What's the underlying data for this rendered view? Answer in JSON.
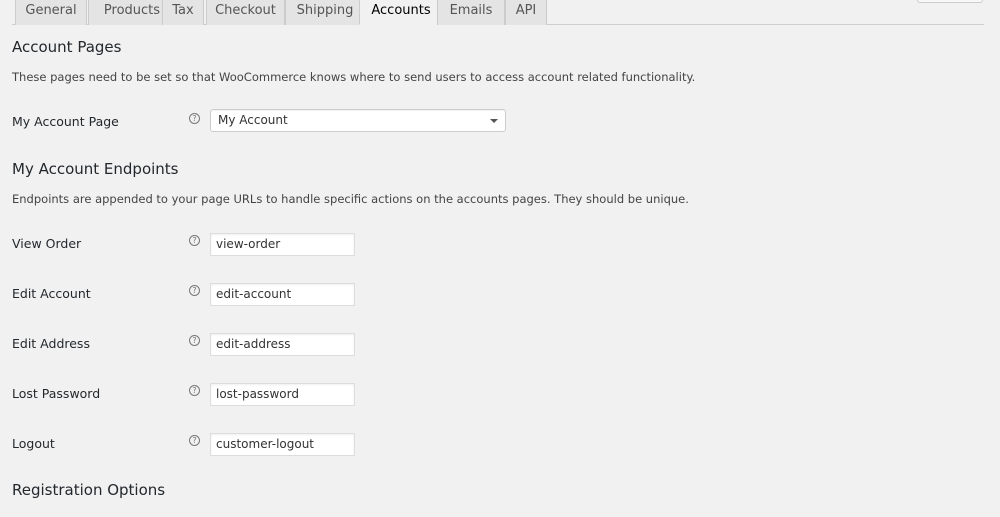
{
  "tabs": [
    {
      "label": "General"
    },
    {
      "label": "Products"
    },
    {
      "label": "Tax"
    },
    {
      "label": "Checkout"
    },
    {
      "label": "Shipping"
    },
    {
      "label": "Accounts",
      "active": true
    },
    {
      "label": "Emails"
    },
    {
      "label": "API"
    }
  ],
  "account_pages": {
    "title": "Account Pages",
    "description": "These pages need to be set so that WooCommerce knows where to send users to access account related functionality.",
    "my_account_page": {
      "label": "My Account Page",
      "value": "My Account",
      "help_icon": "question-mark-icon"
    }
  },
  "endpoints": {
    "title": "My Account Endpoints",
    "description": "Endpoints are appended to your page URLs to handle specific actions on the accounts pages. They should be unique.",
    "fields": [
      {
        "label": "View Order",
        "value": "view-order"
      },
      {
        "label": "Edit Account",
        "value": "edit-account"
      },
      {
        "label": "Edit Address",
        "value": "edit-address"
      },
      {
        "label": "Lost Password",
        "value": "lost-password"
      },
      {
        "label": "Logout",
        "value": "customer-logout"
      }
    ]
  },
  "registration": {
    "title": "Registration Options"
  },
  "help_glyph": "?"
}
